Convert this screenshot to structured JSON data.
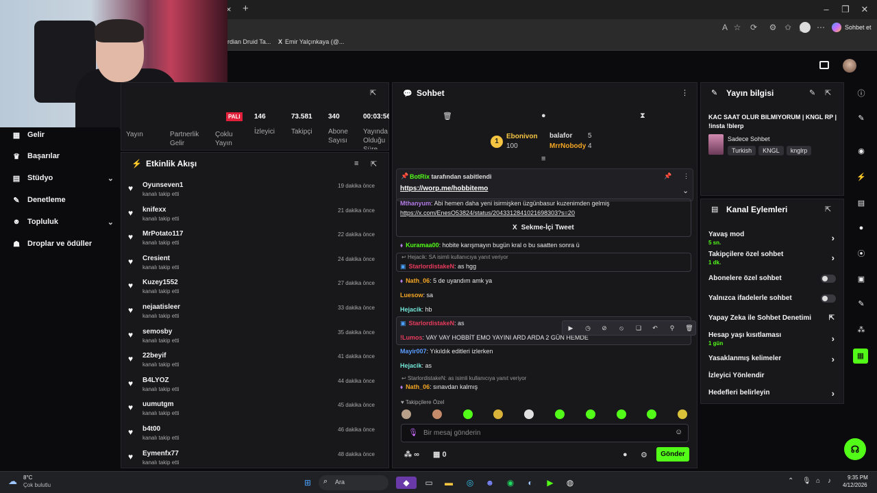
{
  "browser": {
    "bookmarks": [
      "rdian Druid Ta...",
      "Emir Yalçınkaya (@..."
    ],
    "copilot_label": "Sohbet et",
    "close_tab": "×",
    "new_tab": "+"
  },
  "sidebar": {
    "items": [
      {
        "label": "Gelir",
        "icon": "revenue-icon",
        "glyph": "▦"
      },
      {
        "label": "Başarılar",
        "icon": "trophy-icon",
        "glyph": "♛"
      },
      {
        "label": "Stüdyo",
        "icon": "studio-icon",
        "glyph": "▤",
        "chevron": true
      },
      {
        "label": "Denetleme",
        "icon": "wrench-icon",
        "glyph": "✎"
      },
      {
        "label": "Topluluk",
        "icon": "people-icon",
        "glyph": "☻",
        "chevron": true
      },
      {
        "label": "Droplar ve ödüller",
        "icon": "drops-icon",
        "glyph": "☗"
      }
    ]
  },
  "stats": {
    "live_badge": "PALI",
    "items": [
      {
        "label": "Yayın",
        "value": ""
      },
      {
        "label": "Partnerlik\nGelir",
        "value": ""
      },
      {
        "label": "Çoklu\nYayın",
        "value": ""
      },
      {
        "label": "İzleyici",
        "value": "146"
      },
      {
        "label": "Takipçi",
        "value": "73.581"
      },
      {
        "label": "Abone\nSayısı",
        "value": "340"
      },
      {
        "label": "Yayında\nOlduğu\nSüre",
        "value": "00:03:56"
      }
    ]
  },
  "activity": {
    "title": "Etkinlik Akışı",
    "subtitle": "kanalı takip etti",
    "events": [
      {
        "name": "Oyunseven1",
        "time": "19 dakika önce"
      },
      {
        "name": "knifexx",
        "time": "21 dakika önce"
      },
      {
        "name": "MrPotato117",
        "time": "22 dakika önce"
      },
      {
        "name": "Cresient",
        "time": "24 dakika önce"
      },
      {
        "name": "Kuzey1552",
        "time": "27 dakika önce"
      },
      {
        "name": "nejaatisleer",
        "time": "33 dakika önce"
      },
      {
        "name": "semosby",
        "time": "35 dakika önce"
      },
      {
        "name": "22beyif",
        "time": "41 dakika önce"
      },
      {
        "name": "B4LYOZ",
        "time": "44 dakika önce"
      },
      {
        "name": "uumutgm",
        "time": "45 dakika önce"
      },
      {
        "name": "b4t00",
        "time": "46 dakika önce"
      },
      {
        "name": "Eymenfx77",
        "time": "48 dakika önce"
      }
    ]
  },
  "chat": {
    "title": "Sohbet",
    "leaderboard": [
      {
        "rank": "1",
        "name": "Ebonivon",
        "value": "100"
      },
      {
        "name": "balafor",
        "value": "5"
      },
      {
        "name": "MrrNobody",
        "value": "4"
      }
    ],
    "pinned": {
      "by": "BotRix",
      "by_suffix": "tarafından sabitlendi",
      "link": "https://worp.me/hobbitemo"
    },
    "tweet": {
      "user": "Mthanyum",
      "text": ": Abi hemen daha yeni isirmişken üzgünbasur kuzenimden gelmiş",
      "link": "https://x.com/EnesO53824/status/2043312841021698303?s=20",
      "button": "Sekme-İçi Tweet"
    },
    "messages": [
      {
        "user": "Kuramaa00",
        "text": ": hobite karışmayın bugün kral o bu saatten sonra ü"
      },
      {
        "reply": "Hejacik: SA isimli kullanıcıya yanıt veriyor",
        "user": "StarlordistakeN",
        "text": ": as hgg"
      },
      {
        "user": "Nath_06",
        "text": ": 5 de uyandım amk ya"
      },
      {
        "user": "Luesow",
        "text": ": sa"
      },
      {
        "user": "Hejacik",
        "text": ": hb"
      },
      {
        "user": "StarlordistakeN",
        "text": ": as"
      },
      {
        "user": "!Lumos",
        "text": ": VAY VAY HOBBİT EMO YAYINI ARD ARDA 2 GÜN HEMDE"
      },
      {
        "user": "Mayir007",
        "text": ": Yıkıldık editleri izlerken"
      },
      {
        "user": "Hejacik",
        "text": ": as"
      },
      {
        "reply": "StarlordistakeN: as isimli kullanıcıya yanıt veriyor",
        "user": "Nath_06",
        "text": ": sınavdan kalmış"
      }
    ],
    "followers_only_label": "Takipçilere Özel",
    "input_placeholder": "Bir mesaj gönderin",
    "points": "∞",
    "count": "0",
    "send_label": "Gönder"
  },
  "stream_info": {
    "title": "Yayın bilgisi",
    "stream_title": "KAC SAAT OLUR BILMIYORUM | KNGL RP | !insta !blerp",
    "category": "Sadece Sohbet",
    "tags": [
      "Turkish",
      "KNGL",
      "knglrp"
    ]
  },
  "channel_actions": {
    "title": "Kanal Eylemleri",
    "items": [
      {
        "label": "Yavaş mod",
        "sub": "5 sn.",
        "kind": "chevron"
      },
      {
        "label": "Takipçilere özel sohbet",
        "sub": "1 dk.",
        "kind": "chevron"
      },
      {
        "label": "Abonelere özel sohbet",
        "sub": "",
        "kind": "toggle"
      },
      {
        "label": "Yalnızca ifadelerle sohbet",
        "sub": "",
        "kind": "toggle"
      },
      {
        "label": "Yapay Zeka ile Sohbet Denetimi",
        "sub": "",
        "kind": "external"
      },
      {
        "label": "Hesap yaşı kısıtlaması",
        "sub": "1 gün",
        "kind": "chevron"
      },
      {
        "label": "Yasaklanmış kelimeler",
        "sub": "",
        "kind": "chevron"
      },
      {
        "label": "İzleyici Yönlendir",
        "sub": "",
        "kind": "none"
      },
      {
        "label": "Hedefleri belirleyin",
        "sub": "",
        "kind": "chevron"
      }
    ]
  },
  "taskbar": {
    "weather_temp": "8°C",
    "weather_desc": "Çok bulutlu",
    "search_label": "Ara",
    "time": "9:35 PM",
    "date": "4/12/2026"
  },
  "colors": {
    "accent": "#53fc18",
    "panel": "#18181b",
    "bg": "#0b0b0e"
  }
}
